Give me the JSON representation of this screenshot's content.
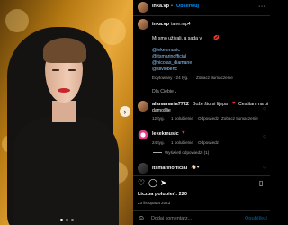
{
  "header": {
    "username": "inka.vp",
    "separator": "•",
    "follow_label": "Obserwuj",
    "more": "···"
  },
  "caption": {
    "username": "inka.vp",
    "location": "tane.mp4",
    "text": "Mi smo uživali, a sada vi",
    "emoji": "💋",
    "mentions": [
      "@lekekmusic",
      "@itsmarinofficial",
      "@nicolas_diamane",
      "@silviobenc"
    ],
    "meta": "Edytowany · 24 tyg.",
    "translate": "Zobacz tłumaczenie"
  },
  "for_you_label": "Dla Ciebie",
  "comments": [
    {
      "username": "alanamaria7722",
      "text": "Bože što si lijepa",
      "heart": "♥",
      "extra": "Čestitam na pi",
      "line2": "damošlje",
      "meta": {
        "age": "12 tyg.",
        "likes": "1 polubienie",
        "reply": "Odpowiedz",
        "translate": "Zobacz tłumaczenie"
      }
    },
    {
      "username": "lekekmusic",
      "heart": "♥",
      "meta": {
        "age": "24 tyg.",
        "likes": "1 polubienie",
        "reply": "Odpowiedz"
      },
      "view_replies": "Wyświetl odpowiedzi (1)"
    },
    {
      "username": "itsmarinofficial",
      "text": "👋🏻♥"
    }
  ],
  "likes": "Liczba polubień: 220",
  "date": "23 listopada 2023",
  "comment_input": {
    "placeholder": "Dodaj komentarz...",
    "emoji_icon": "☺",
    "publish": "Opublikuj"
  },
  "colors": {
    "accent": "#0095f6",
    "heart": "#ed2a3a",
    "bg": "#000000"
  },
  "icons": [
    "heart-icon",
    "comment-icon",
    "share-icon",
    "bookmark-icon",
    "emoji-icon",
    "more-icon",
    "chevron-right-icon"
  ]
}
